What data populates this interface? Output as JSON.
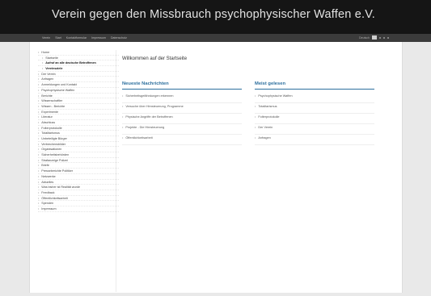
{
  "header": {
    "site_title": "Verein gegen den Missbrauch psychophysischer Waffen e.V."
  },
  "nav": {
    "items": [
      "Verein",
      "Start",
      "Kontaktformular",
      "Impressum",
      "Datenschutz"
    ]
  },
  "language": {
    "label": "Deutsch"
  },
  "sidebar": {
    "items": [
      {
        "label": "Home",
        "level": 0,
        "active": false
      },
      {
        "label": "Startseite",
        "level": 1,
        "active": false
      },
      {
        "label": "Aufruf an alle deutsche Betroffenen",
        "level": 1,
        "active": true
      },
      {
        "label": "Vereinsziele",
        "level": 1,
        "active": true
      },
      {
        "label": "Der Verein",
        "level": 0,
        "active": false
      },
      {
        "label": "Anfragen",
        "level": 0,
        "active": false
      },
      {
        "label": "Anmeldungen und Kontakt",
        "level": 0,
        "active": false
      },
      {
        "label": "Psychophysische Waffen",
        "level": 0,
        "active": false
      },
      {
        "label": "Berichte",
        "level": 0,
        "active": false
      },
      {
        "label": "Wissenschaftler",
        "level": 0,
        "active": false
      },
      {
        "label": "Wissen - Berichte",
        "level": 0,
        "active": false
      },
      {
        "label": "Experimente",
        "level": 0,
        "active": false
      },
      {
        "label": "Literatur",
        "level": 0,
        "active": false
      },
      {
        "label": "Abschluss",
        "level": 0,
        "active": false
      },
      {
        "label": "Folterprotokolle",
        "level": 0,
        "active": false
      },
      {
        "label": "Totalitarismus",
        "level": 0,
        "active": false
      },
      {
        "label": "Unbeteiligte Bürger",
        "level": 0,
        "active": false
      },
      {
        "label": "Verbrechensbilder",
        "level": 0,
        "active": false
      },
      {
        "label": "Organisationen",
        "level": 0,
        "active": false
      },
      {
        "label": "Sicherheitsbehörden",
        "level": 0,
        "active": false
      },
      {
        "label": "Strafanzeige Polizei",
        "level": 0,
        "active": false
      },
      {
        "label": "Briefe",
        "level": 0,
        "active": false
      },
      {
        "label": "Presseberichte Politiker",
        "level": 0,
        "active": false
      },
      {
        "label": "Netzwerke",
        "level": 0,
        "active": false
      },
      {
        "label": "Aktuelles",
        "level": 0,
        "active": false
      },
      {
        "label": "Was bisher ist Realität wurde",
        "level": 0,
        "active": false
      },
      {
        "label": "Feedback",
        "level": 0,
        "active": false
      },
      {
        "label": "Öffentlichkeitsarbeit",
        "level": 0,
        "active": false
      },
      {
        "label": "Spenden",
        "level": 0,
        "active": false
      },
      {
        "label": "Impressum",
        "level": 0,
        "active": false
      }
    ]
  },
  "main": {
    "welcome": "Willkommen auf der Startseite",
    "news": {
      "title": "Neueste Nachrichten",
      "items": [
        "Sicherheitsgefährdungen erkennen",
        "Versuche über Hirnsteuerung, Programme",
        "Physische Angriffe der Betroffenen",
        "Projekte - Die Hirnsteuerung",
        "Öffentlichkeitsarbeit"
      ]
    },
    "popular": {
      "title": "Meist gelesen",
      "items": [
        "Psychophysische Waffen",
        "Totalitarismus",
        "Folterprotokolle",
        "Der Verein",
        "Anfragen"
      ]
    }
  }
}
